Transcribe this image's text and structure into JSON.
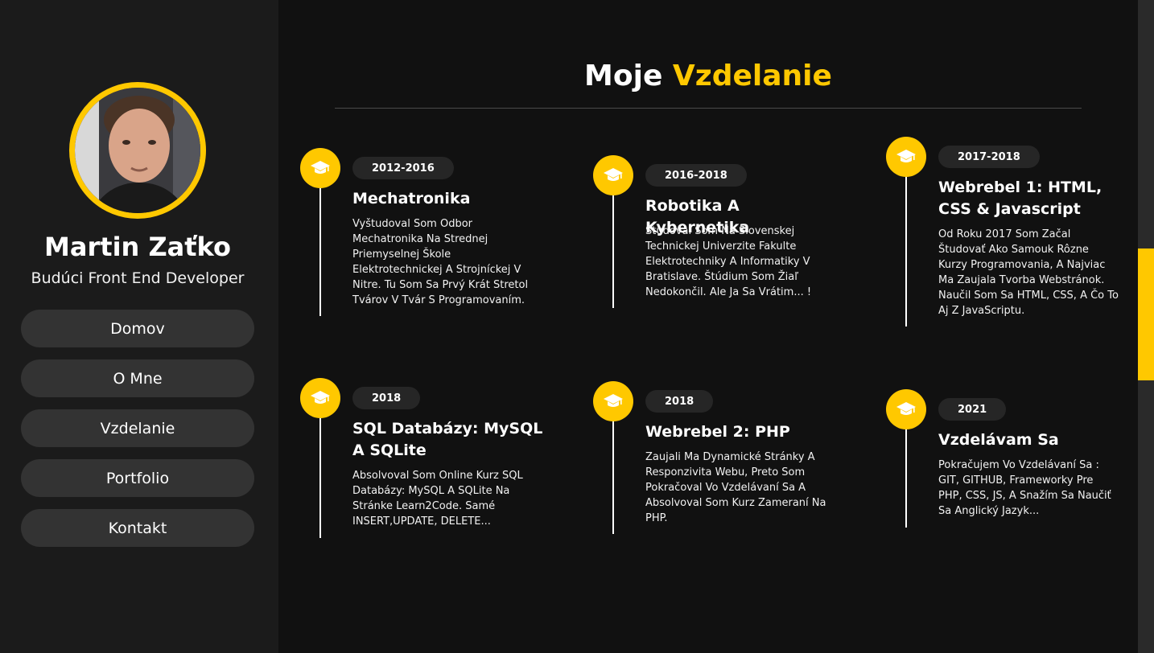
{
  "profile": {
    "name": "Martin Zaťko",
    "role": "Budúci Front End Developer"
  },
  "nav": {
    "items": [
      {
        "label": "Domov"
      },
      {
        "label": "O Mne"
      },
      {
        "label": "Vzdelanie"
      },
      {
        "label": "Portfolio"
      },
      {
        "label": "Kontakt"
      }
    ]
  },
  "section": {
    "title_prefix": "Moje",
    "title_accent": "Vzdelanie"
  },
  "colors": {
    "accent": "#ffc800",
    "background": "#111111",
    "sidebar": "#1b1b1b",
    "button": "#333333",
    "pill": "#262626"
  },
  "education": [
    {
      "icon": "graduation-cap-icon",
      "years": "2012-2016",
      "title": "Mechatronika",
      "description": "Vyštudoval Som Odbor Mechatronika Na Strednej Priemyselnej Škole Elektrotechnickej A Strojníckej V Nitre. Tu Som Sa Prvý Krát Stretol Tvárov V Tvár S Programovaním."
    },
    {
      "icon": "graduation-cap-icon",
      "years": "2016-2018",
      "title": "Robotika A Kybernetika",
      "description": "Študoval Som Na Slovenskej Technickej Univerzite Fakulte Elektrotechniky A Informatiky V Bratislave. Štúdium Som Žiaľ Nedokončil. Ale Ja Sa Vrátim... !"
    },
    {
      "icon": "graduation-cap-icon",
      "years": "2017-2018",
      "title": "Webrebel 1: HTML, CSS & Javascript",
      "description": "Od Roku 2017 Som Začal Študovať Ako Samouk Rôzne Kurzy Programovania, A Najviac Ma Zaujala Tvorba Webstránok. Naučil Som Sa HTML, CSS, A Čo To Aj Z JavaScriptu."
    },
    {
      "icon": "graduation-cap-icon",
      "years": "2018",
      "title": "SQL Databázy: MySQL A SQLite",
      "description": "Absolvoval Som Online Kurz SQL Databázy: MySQL A SQLite Na Stránke Learn2Code. Samé INSERT,UPDATE, DELETE..."
    },
    {
      "icon": "graduation-cap-icon",
      "years": "2018",
      "title": "Webrebel 2: PHP",
      "description": "Zaujali Ma Dynamické Stránky A Responzivita Webu, Preto Som Pokračoval Vo Vzdelávaní Sa A Absolvoval Som Kurz Zameraní Na PHP."
    },
    {
      "icon": "graduation-cap-icon",
      "years": "2021",
      "title": "Vzdelávam Sa",
      "description": "Pokračujem Vo Vzdelávaní Sa : GIT, GITHUB, Frameworky Pre PHP, CSS, JS, A Snažím Sa Naučiť Sa Anglický Jazyk..."
    }
  ]
}
